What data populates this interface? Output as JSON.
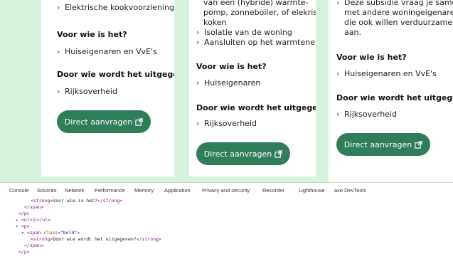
{
  "card1": {
    "item0": "Elektrische kookvoorziening",
    "heading_who": "Voor wie is het?",
    "item_who": "Huiseigenaren en VvE's",
    "heading_by": "Door wie wordt het uitgegeven?",
    "item_by": "Rijksoverheid",
    "cta": "Direct aanvragen"
  },
  "card2": {
    "line0": "van een (hybride) warmte-",
    "line1": "pomp, zonneboiler, of elekrisch",
    "line2": "koken",
    "item_iso": "Isolatie van de woning",
    "item_warm": "Aansluiten op het warmtenet",
    "heading_who": "Voor wie is het?",
    "item_who": "Huiseigenaren",
    "heading_by": "Door wie wordt het uitgegeven?",
    "item_by": "Rijksoverheid",
    "cta": "Direct aanvragen"
  },
  "card3": {
    "line0": "Deze subsidie vraag je samen",
    "line1": "met andere woningeigenaren",
    "line2": "die ook willen verduurzamen",
    "line3": "aan.",
    "heading_who": "Voor wie is het?",
    "item_who": "Huiseigenaren en VvE's",
    "heading_by": "Door wie wordt het uitgegeven?",
    "item_by": "Rijksoverheid",
    "cta": "Direct aanvragen"
  },
  "devtools": {
    "tabs": [
      "Console",
      "Sources",
      "Network",
      "Performance",
      "Memory",
      "Application",
      "Privacy and security",
      "Recorder",
      "Lighthouse",
      "axe DevTools"
    ],
    "code": {
      "l1_open": "<strong>",
      "l1_text": "Voor wie is het?",
      "l1_close": "</strong>",
      "l2": "</span>",
      "l3": "</p>",
      "l4_open": "<ul>",
      "l4_dots": "⋯",
      "l4_close": "</ul>",
      "l5": "<p>",
      "l6_open": "<span ",
      "l6_attr": "class",
      "l6_val": "\"bold\"",
      "l6_close": ">",
      "l7_open": "<strong>",
      "l7_text": "Door wie wordt het uitgegeven?",
      "l7_close": "</strong>",
      "l8": "</span>",
      "l9": "</p>"
    }
  },
  "colors": {
    "page_bg": "#d7f3de",
    "button": "#2f7d5b"
  }
}
